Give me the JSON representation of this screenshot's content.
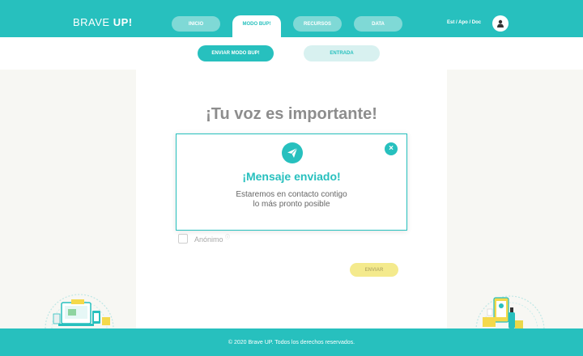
{
  "header": {
    "brand_main": "BRAVE ",
    "brand_bold": "UP!",
    "nav": [
      {
        "label": "INICIO"
      },
      {
        "label": "MODO BUP!"
      },
      {
        "label": "RECURSOS"
      },
      {
        "label": "DATA"
      }
    ],
    "roles": "Est / Apo / Doc",
    "avatar_icon": "user-icon"
  },
  "subnav": {
    "send_label": "ENVIAR MODO BUP!",
    "inbox_label": "ENTRADA"
  },
  "form": {
    "heading": "¡Tu voz es importante!",
    "anonymous_label": "Anónimo",
    "anonymous_checked": false,
    "info_icon": "info-icon",
    "send_label": "ENVIAR"
  },
  "modal": {
    "icon": "paper-plane-icon",
    "close_icon": "close-icon",
    "title": "¡Mensaje enviado!",
    "line1": "Estaremos en contacto contigo",
    "line2": "lo más pronto posible"
  },
  "footer": {
    "text": "© 2020 Brave UP. Todos los derechos reservados."
  },
  "colors": {
    "accent": "#27c0be",
    "accent_light": "#7fd9d6",
    "send_button": "#f4ea8d",
    "background": "#f7f7f3"
  }
}
